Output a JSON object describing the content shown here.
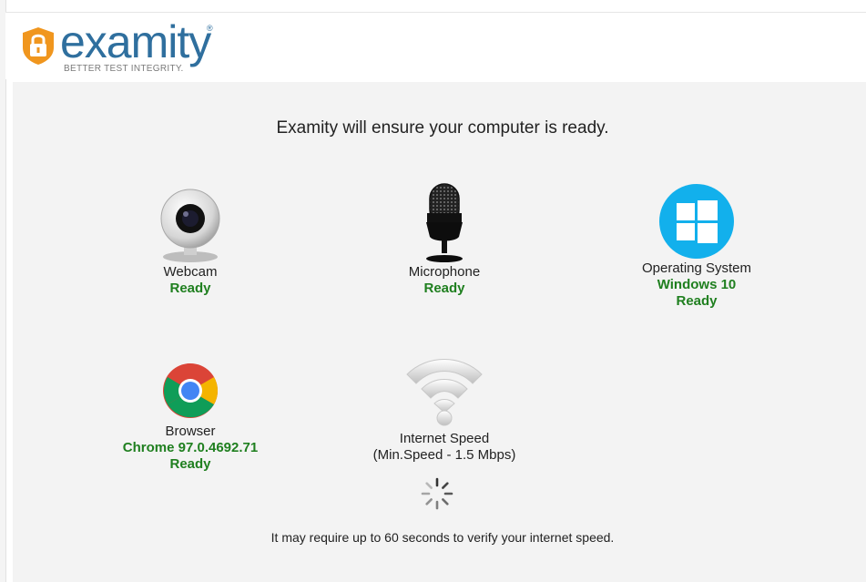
{
  "brand": {
    "name": "examity",
    "registered": "®",
    "tagline": "BETTER TEST INTEGRITY.",
    "color": "#2f6f9e",
    "mark_color": "#f0961e"
  },
  "heading": "Examity will ensure your computer is ready.",
  "checks": {
    "webcam": {
      "label": "Webcam",
      "status": "Ready",
      "icon": "webcam-icon"
    },
    "microphone": {
      "label": "Microphone",
      "status": "Ready",
      "icon": "microphone-icon"
    },
    "os": {
      "label": "Operating System",
      "value": "Windows 10",
      "status": "Ready",
      "icon": "windows-icon"
    },
    "browser": {
      "label": "Browser",
      "value": "Chrome 97.0.4692.71",
      "status": "Ready",
      "icon": "chrome-icon"
    },
    "internet": {
      "label": "Internet Speed",
      "sublabel": "(Min.Speed - 1.5 Mbps)",
      "icon": "wifi-icon",
      "state": "loading"
    }
  },
  "note": "It may require up to 60 seconds to verify your internet speed.",
  "colors": {
    "ready": "#1f7f1f",
    "windows": "#12b0ec",
    "panel": "#f3f3f3"
  }
}
